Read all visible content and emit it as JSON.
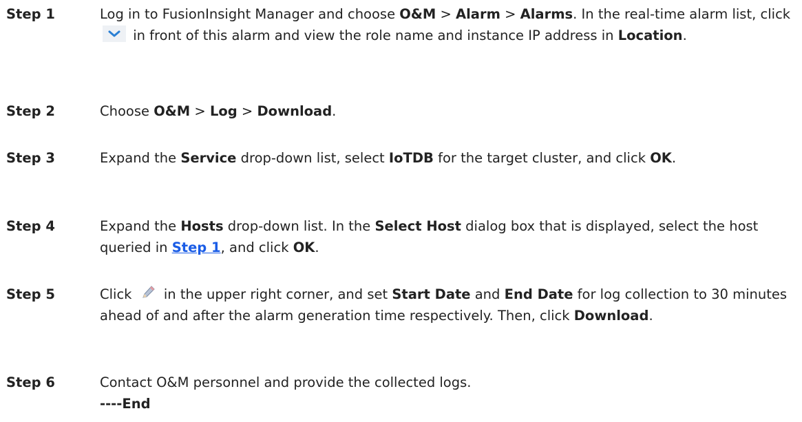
{
  "steps": [
    {
      "label": "Step 1",
      "parts": {
        "t1": "Log in to FusionInsight Manager and choose ",
        "b1": "O&M",
        "t2": " > ",
        "b2": "Alarm",
        "t3": " > ",
        "b3": "Alarms",
        "t4": ". In the real-time alarm list, click ",
        "t5": " in front of this alarm and view the role name and instance IP address in ",
        "b4": "Location",
        "t6": "."
      },
      "icon": "chevron-down-icon"
    },
    {
      "label": "Step 2",
      "parts": {
        "t1": "Choose ",
        "b1": "O&M",
        "t2": " > ",
        "b2": "Log",
        "t3": " > ",
        "b3": "Download",
        "t4": "."
      }
    },
    {
      "label": "Step 3",
      "parts": {
        "t1": "Expand the ",
        "b1": "Service",
        "t2": " drop-down list, select ",
        "b2": "IoTDB",
        "t3": " for the target cluster, and click ",
        "b3": "OK",
        "t4": "."
      }
    },
    {
      "label": "Step 4",
      "parts": {
        "t1": "Expand the ",
        "b1": "Hosts",
        "t2": " drop-down list. In the ",
        "b2": "Select Host",
        "t3": " dialog box that is displayed, select the host queried in ",
        "link": "Step 1",
        "t4": ", and click ",
        "b3": "OK",
        "t5": "."
      }
    },
    {
      "label": "Step 5",
      "parts": {
        "t1": "Click ",
        "t2": " in the upper right corner, and set ",
        "b1": "Start Date",
        "t3": " and ",
        "b2": "End Date",
        "t4": " for log collection to 30 minutes ahead of and after the alarm generation time respectively. Then, click ",
        "b3": "Download",
        "t5": "."
      },
      "icon": "pencil-icon"
    },
    {
      "label": "Step 6",
      "parts": {
        "t1": "Contact O&M personnel and provide the collected logs."
      }
    }
  ],
  "end_text": "----End",
  "colors": {
    "text": "#222222",
    "link": "#1a5ce6",
    "chevron": "#2a7fd4",
    "chevron_bg": "#eef1f5"
  }
}
